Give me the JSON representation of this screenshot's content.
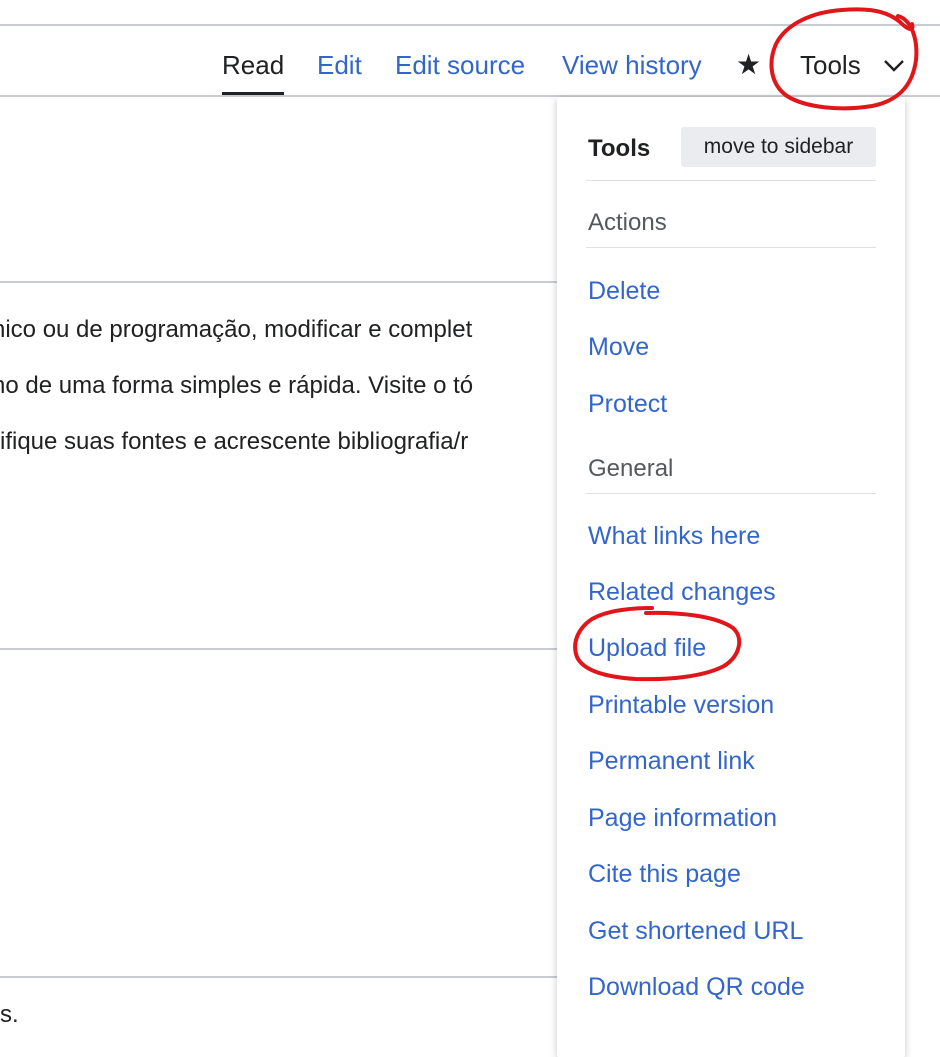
{
  "tabs": {
    "read": "Read",
    "edit": "Edit",
    "edit_source": "Edit source",
    "view_history": "View history",
    "star_icon": "star-icon",
    "tools": "Tools",
    "chevron_icon": "chevron-down-icon"
  },
  "content": {
    "lines": [
      "nico ou de programação, modificar e complet",
      "no de uma forma simples e rápida. Visite o tó",
      "rifique suas fontes e acrescente bibliografia/r"
    ],
    "footer_fragment": "s."
  },
  "tools_menu": {
    "title": "Tools",
    "move_button": "move to sidebar",
    "actions_heading": "Actions",
    "actions": [
      "Delete",
      "Move",
      "Protect"
    ],
    "general_heading": "General",
    "general": [
      "What links here",
      "Related changes",
      "Upload file",
      "Printable version",
      "Permanent link",
      "Page information",
      "Cite this page",
      "Get shortened URL",
      "Download QR code"
    ]
  },
  "colors": {
    "link": "#3366cc",
    "text": "#202122",
    "annotation": "#e0161b"
  }
}
